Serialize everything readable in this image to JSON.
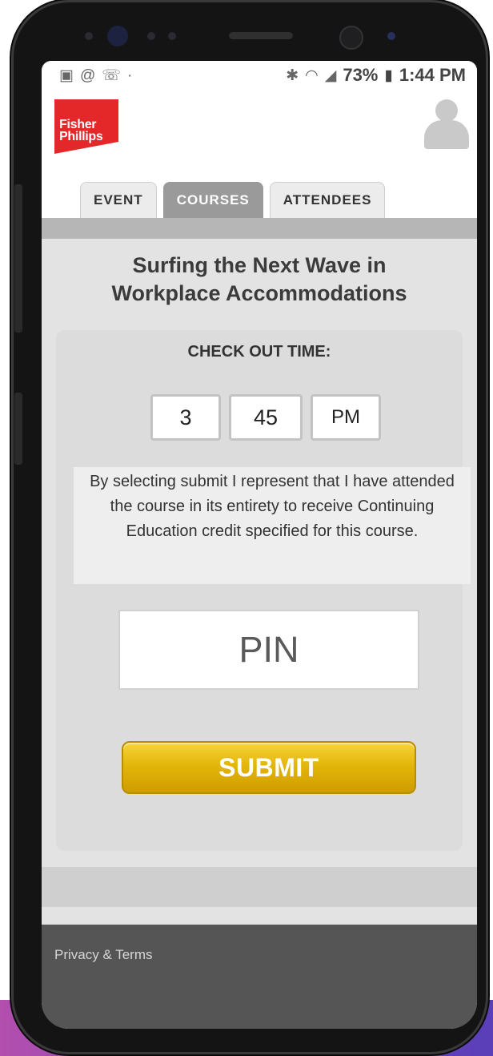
{
  "status_bar": {
    "battery": "73%",
    "time": "1:44 PM",
    "left_icons": [
      "gallery-icon",
      "at-icon",
      "wifi-call-icon"
    ],
    "right_icons": [
      "bluetooth-icon",
      "wifi-icon",
      "signal-icon",
      "battery-icon"
    ]
  },
  "header": {
    "logo_line1": "Fisher",
    "logo_line2": "Phillips",
    "brand_color": "#e4282a"
  },
  "tabs": [
    {
      "label": "EVENT",
      "active": false
    },
    {
      "label": "COURSES",
      "active": true
    },
    {
      "label": "ATTENDEES",
      "active": false
    }
  ],
  "course": {
    "title_line1": "Surfing the Next Wave in",
    "title_line2": "Workplace Accommodations"
  },
  "checkout": {
    "label": "CHECK OUT TIME:",
    "hour": "3",
    "minute": "45",
    "ampm": "PM"
  },
  "disclaimer": {
    "text": "By selecting submit I represent that I have attended the course in its entirety to receive Continuing Education credit specified for this course."
  },
  "pin": {
    "placeholder": "PIN",
    "value": ""
  },
  "submit": {
    "label": "SUBMIT",
    "color": "#e3b60a"
  },
  "footer": {
    "link": "Privacy & Terms"
  }
}
